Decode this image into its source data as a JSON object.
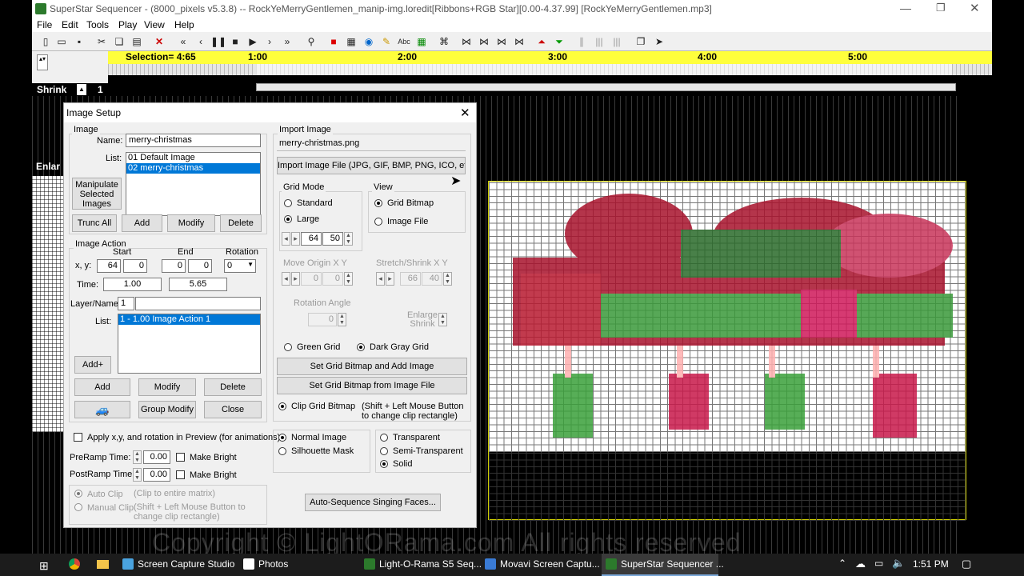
{
  "window": {
    "title": "SuperStar Sequencer - (8000_pixels v5.3.8) -- RockYeMerryGentlemen_manip-img.loredit[Ribbons+RGB Star][0.00-4.37.99] [RockYeMerryGentlemen.mp3]"
  },
  "menu": [
    "File",
    "Edit",
    "Tools",
    "Play",
    "View",
    "Help"
  ],
  "timeline": {
    "selection": "Selection= 4:65",
    "ticks": [
      "1:00",
      "2:00",
      "3:00",
      "4:00",
      "5:00"
    ]
  },
  "left_panel": {
    "shrink": "Shrink",
    "shrink_value": "1",
    "enlarge": "Enlar"
  },
  "dialog": {
    "title": "Image Setup",
    "image_group": "Image",
    "name_label": "Name:",
    "name_value": "merry-christmas",
    "list_label": "List:",
    "image_list": [
      "01 Default Image",
      "02 merry-christmas"
    ],
    "manipulate_btn": "Manipulate Selected Images",
    "trunc_all": "Trunc All",
    "add": "Add",
    "modify": "Modify",
    "delete": "Delete",
    "image_action_group": "Image Action",
    "start": "Start",
    "end": "End",
    "rotation": "Rotation",
    "xy_label": "x, y:",
    "start_x": "64",
    "start_y": "0",
    "end_x": "0",
    "end_y": "0",
    "rotation_value": "0",
    "time_label": "Time:",
    "time_start": "1.00",
    "time_end": "5.65",
    "layer_label": "Layer/Name",
    "layer_value": "1",
    "action_list_label": "List:",
    "action_list": [
      "1 - 1.00  Image Action 1"
    ],
    "add_plus": "Add+",
    "group_modify": "Group Modify",
    "close": "Close",
    "apply_chk": "Apply x,y, and rotation in Preview (for animations)",
    "preramp_label": "PreRamp Time:",
    "preramp_value": "0.00",
    "postramp_label": "PostRamp Time:",
    "postramp_value": "0.00",
    "make_bright": "Make Bright",
    "auto_clip": "Auto Clip",
    "auto_clip_note": "(Clip to entire matrix)",
    "manual_clip": "Manual Clip",
    "manual_clip_note": "(Shift + Left Mouse Button to change clip rectangle)",
    "import_group": "Import Image",
    "import_file": "merry-christmas.png",
    "import_btn": "Import Image File (JPG, GIF, BMP, PNG, ICO, etc.)",
    "grid_mode": "Grid Mode",
    "standard": "Standard",
    "large": "Large",
    "grid_w": "64",
    "grid_h": "50",
    "view": "View",
    "grid_bitmap": "Grid Bitmap",
    "image_file": "Image File",
    "move_origin": "Move Origin X Y",
    "origin_x": "0",
    "origin_y": "0",
    "stretch": "Stretch/Shrink X Y",
    "stretch_x": "66",
    "stretch_y": "40",
    "rotation_angle": "Rotation Angle",
    "rotation_angle_value": "0",
    "enlarge_shrink": "Enlarge Shrink",
    "green_grid": "Green Grid",
    "dark_gray_grid": "Dark Gray Grid",
    "set_add_btn": "Set Grid Bitmap and Add Image",
    "set_file_btn": "Set Grid Bitmap from Image File",
    "clip_grid": "Clip Grid Bitmap",
    "clip_note": "(Shift + Left Mouse Button to change clip rectangle)",
    "normal_image": "Normal Image",
    "silhouette": "Silhouette Mask",
    "transparent": "Transparent",
    "semi_transparent": "Semi-Transparent",
    "solid": "Solid",
    "auto_sequence": "Auto-Sequence Singing Faces..."
  },
  "watermark": "Copyright © LightORama.com     All rights reserved",
  "taskbar": {
    "items": [
      "Screen Capture Studio",
      "Photos",
      "Light-O-Rama S5 Seq...",
      "Movavi Screen Captu...",
      "SuperStar Sequencer ..."
    ],
    "clock": "1:51 PM"
  },
  "colors": {
    "timeline": "#ffff3c",
    "selection": "#0078d7",
    "ribbon_red": "#b0102a",
    "green": "#3a9a3a"
  }
}
